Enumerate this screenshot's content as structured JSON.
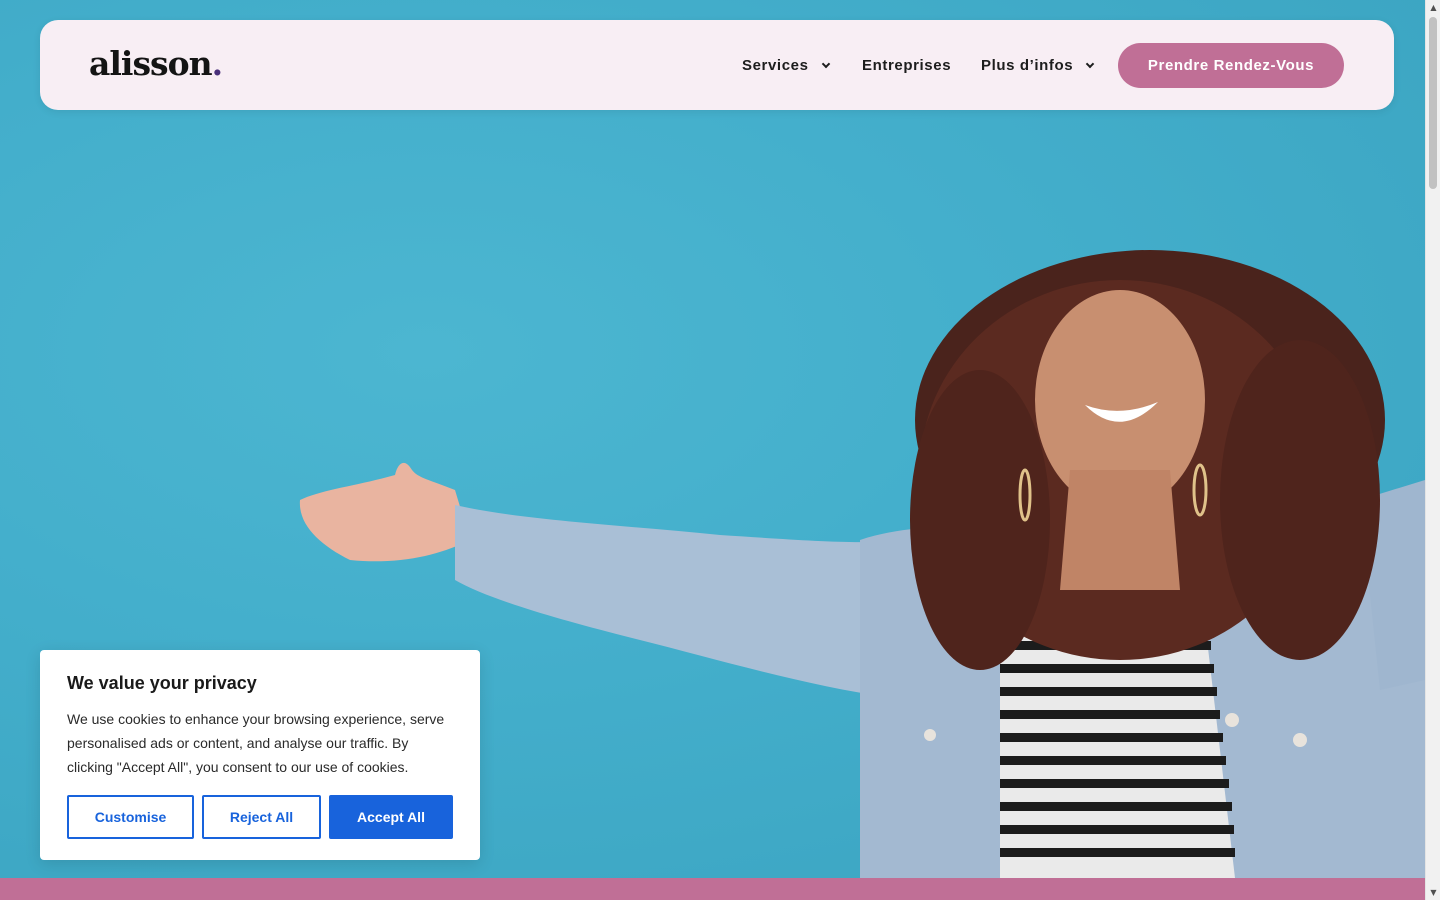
{
  "header": {
    "logo": "alisson",
    "logo_dot": ".",
    "nav": {
      "services": "Services",
      "entreprises": "Entreprises",
      "plus_infos": "Plus d’infos"
    },
    "cta": "Prendre Rendez-Vous"
  },
  "cookie_banner": {
    "title": "We value your privacy",
    "text": "We use cookies to enhance your browsing experience, serve personalised ads or content, and analyse our traffic. By clicking \"Accept All\", you consent to our use of cookies.",
    "customise": "Customise",
    "reject": "Reject All",
    "accept": "Accept All"
  },
  "colors": {
    "brand_pink": "#c06f96",
    "hero_blue": "#43aecb",
    "header_bg": "#f8eef4",
    "cookie_accent": "#1863dc"
  },
  "scrollbar": {
    "up_icon": "▲",
    "down_icon": "▼"
  }
}
